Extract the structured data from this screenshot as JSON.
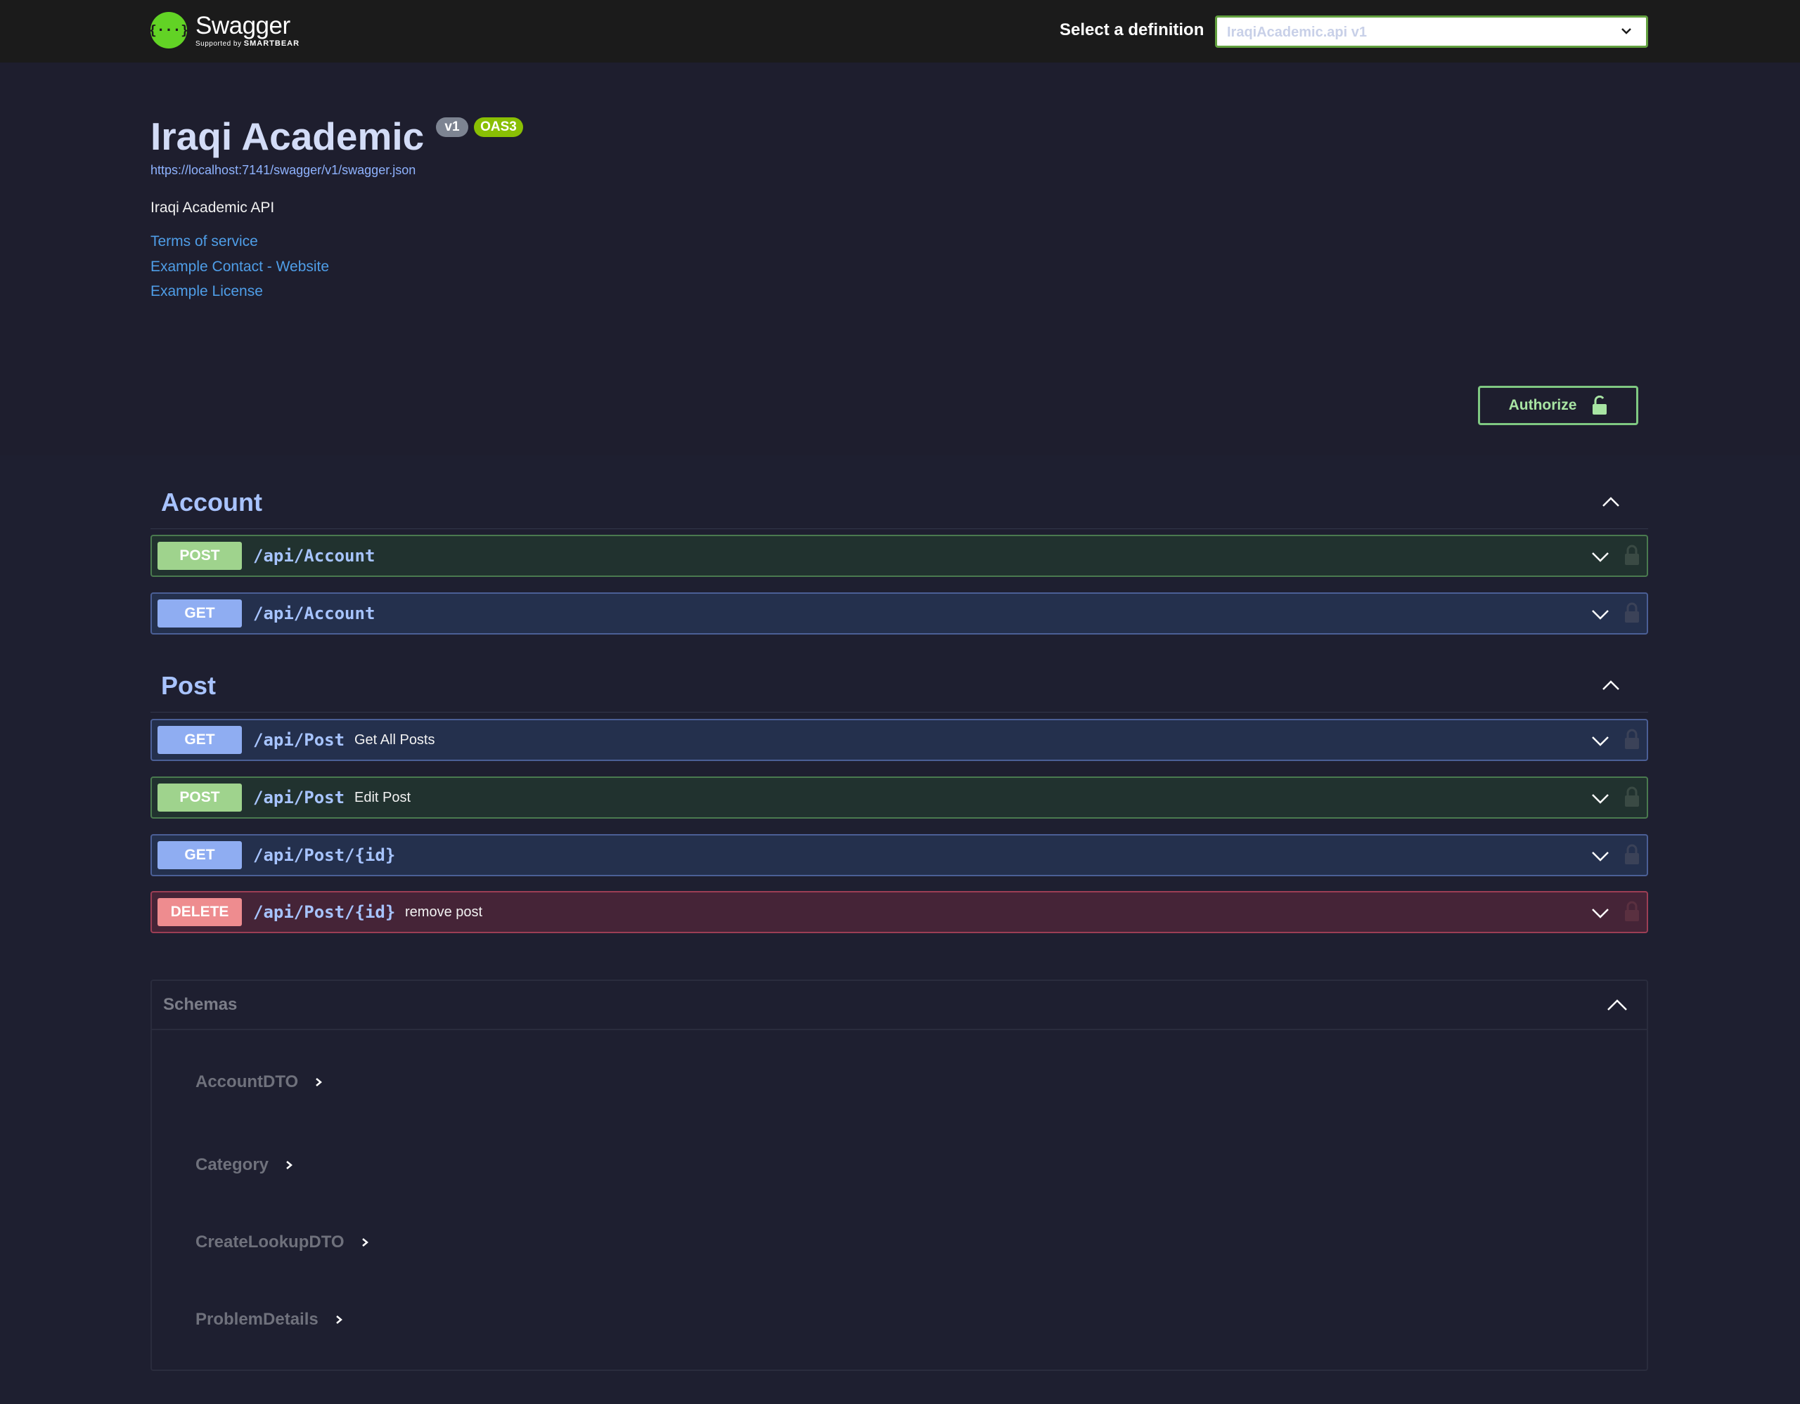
{
  "header": {
    "logo_name": "Swagger",
    "logo_sub_prefix": "Supported by",
    "logo_sub_brand": "SMARTBEAR",
    "definition_label": "Select a definition",
    "definition_selected": "IraqiAcademic.api v1"
  },
  "info": {
    "title": "Iraqi Academic",
    "version_badge": "v1",
    "oas_badge": "OAS3",
    "spec_url": "https://localhost:7141/swagger/v1/swagger.json",
    "description": "Iraqi Academic API",
    "links": [
      "Terms of service",
      "Example Contact - Website",
      "Example License"
    ]
  },
  "authorize": {
    "label": "Authorize"
  },
  "tags": [
    {
      "name": "Account",
      "operations": [
        {
          "method": "POST",
          "path": "/api/Account",
          "summary": ""
        },
        {
          "method": "GET",
          "path": "/api/Account",
          "summary": ""
        }
      ]
    },
    {
      "name": "Post",
      "operations": [
        {
          "method": "GET",
          "path": "/api/Post",
          "summary": "Get All Posts"
        },
        {
          "method": "POST",
          "path": "/api/Post",
          "summary": "Edit Post"
        },
        {
          "method": "GET",
          "path": "/api/Post/{id}",
          "summary": ""
        },
        {
          "method": "DELETE",
          "path": "/api/Post/{id}",
          "summary": "remove post"
        }
      ]
    }
  ],
  "schemas": {
    "title": "Schemas",
    "items": [
      "AccountDTO",
      "Category",
      "CreateLookupDTO",
      "ProblemDetails"
    ]
  },
  "colors": {
    "post": "#9fd38d",
    "get": "#8fadf2",
    "delete": "#ee8c8f",
    "brand": "#62d325"
  }
}
